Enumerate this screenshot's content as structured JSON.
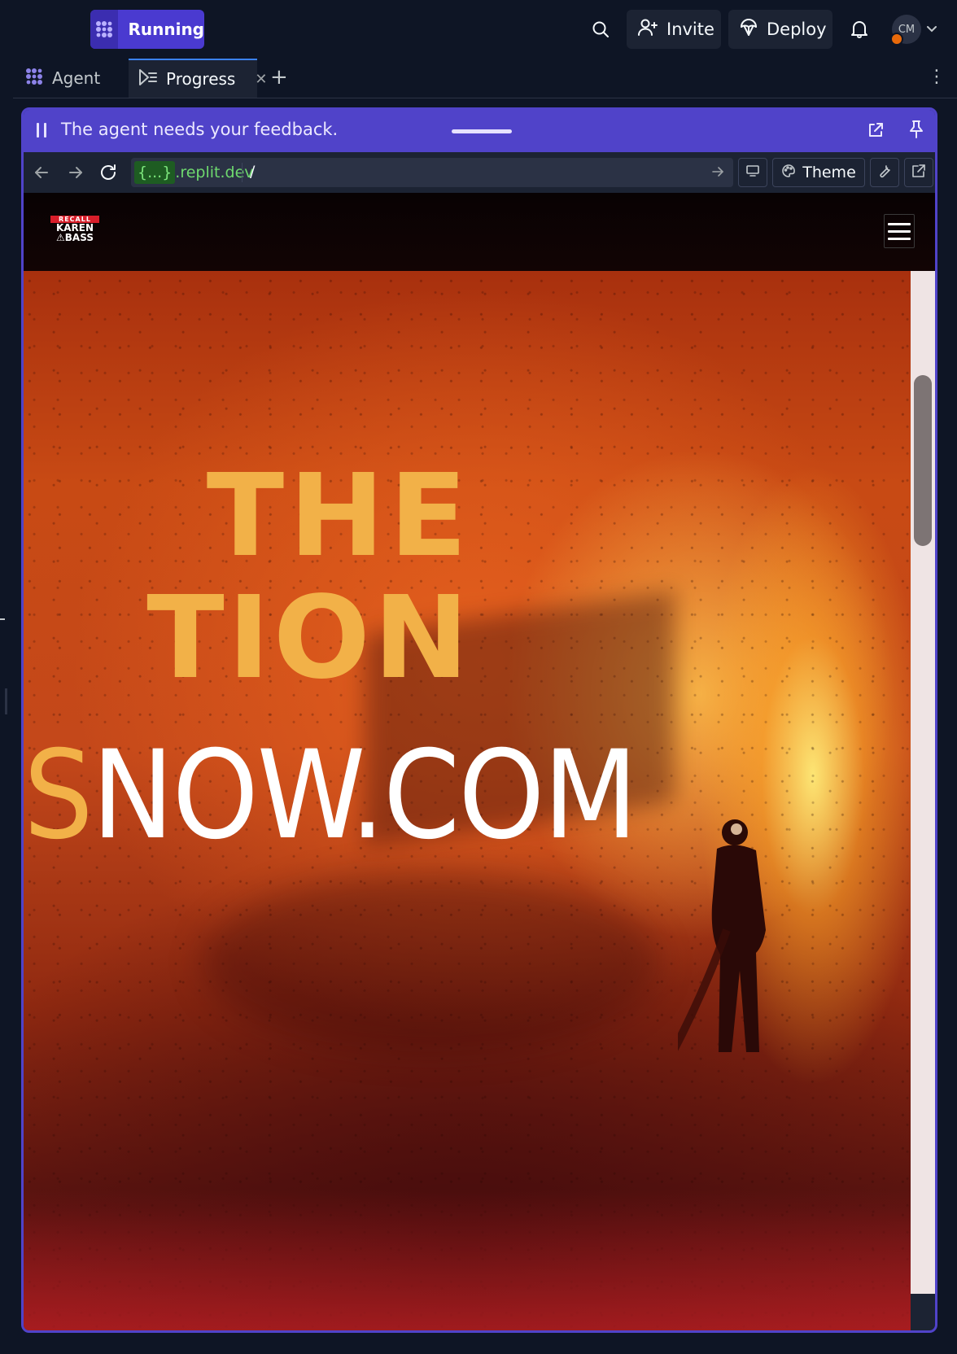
{
  "topbar": {
    "run_label": "Running",
    "invite_label": "Invite",
    "deploy_label": "Deploy",
    "avatar_initials": "CM"
  },
  "tabs": [
    {
      "label": "Agent",
      "icon": "agent-icon"
    },
    {
      "label": "Progress",
      "icon": "progress-icon",
      "active": true
    }
  ],
  "feedback": {
    "message": "The agent needs your feedback."
  },
  "browser": {
    "url_prefix": "{...}",
    "url_domain": ".replit.dev",
    "url_path": "/",
    "theme_label": "Theme"
  },
  "site": {
    "logo": {
      "recall": "RECALL",
      "line1": "KAREN",
      "line2": "⚠BASS"
    },
    "hero": {
      "line1": "THE",
      "line2": "TION",
      "line3_accent": "S",
      "line3_rest": "NOW.COM"
    }
  },
  "colors": {
    "accent": "#5043c9",
    "run_button": "#4a3ad0",
    "hero_yellow": "#f2b148",
    "url_green": "#6ed96e"
  }
}
